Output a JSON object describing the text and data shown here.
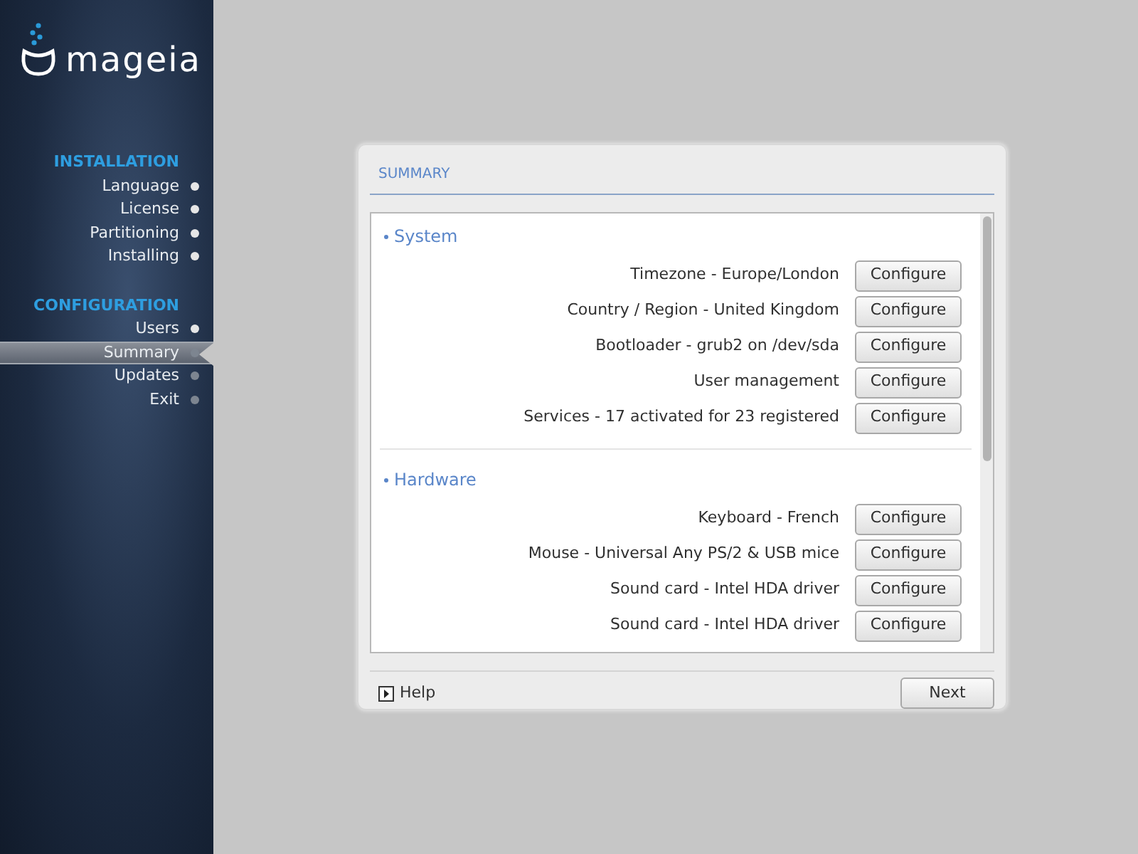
{
  "logo": {
    "text": "mageia"
  },
  "sidebar": {
    "sections": [
      {
        "title": "INSTALLATION",
        "items": [
          {
            "label": "Language",
            "done": true,
            "selected": false
          },
          {
            "label": "License",
            "done": true,
            "selected": false
          },
          {
            "label": "Partitioning",
            "done": true,
            "selected": false
          },
          {
            "label": "Installing",
            "done": true,
            "selected": false
          }
        ]
      },
      {
        "title": "CONFIGURATION",
        "items": [
          {
            "label": "Users",
            "done": true,
            "selected": false
          },
          {
            "label": "Summary",
            "done": false,
            "selected": true
          },
          {
            "label": "Updates",
            "done": false,
            "selected": false
          },
          {
            "label": "Exit",
            "done": false,
            "selected": false
          }
        ]
      }
    ]
  },
  "dialog": {
    "title": "SUMMARY",
    "groups": [
      {
        "title": "System",
        "rows": [
          {
            "label": "Timezone - Europe/London",
            "button": "Configure"
          },
          {
            "label": "Country / Region - United Kingdom",
            "button": "Configure"
          },
          {
            "label": "Bootloader - grub2 on /dev/sda",
            "button": "Configure"
          },
          {
            "label": "User management",
            "button": "Configure"
          },
          {
            "label": "Services - 17 activated for 23 registered",
            "button": "Configure"
          }
        ]
      },
      {
        "title": "Hardware",
        "rows": [
          {
            "label": "Keyboard - French",
            "button": "Configure"
          },
          {
            "label": "Mouse - Universal Any PS/2 & USB mice",
            "button": "Configure"
          },
          {
            "label": "Sound card - Intel HDA driver",
            "button": "Configure"
          },
          {
            "label": "Sound card - Intel HDA driver",
            "button": "Configure"
          }
        ]
      }
    ],
    "help": "Help",
    "next": "Next"
  }
}
